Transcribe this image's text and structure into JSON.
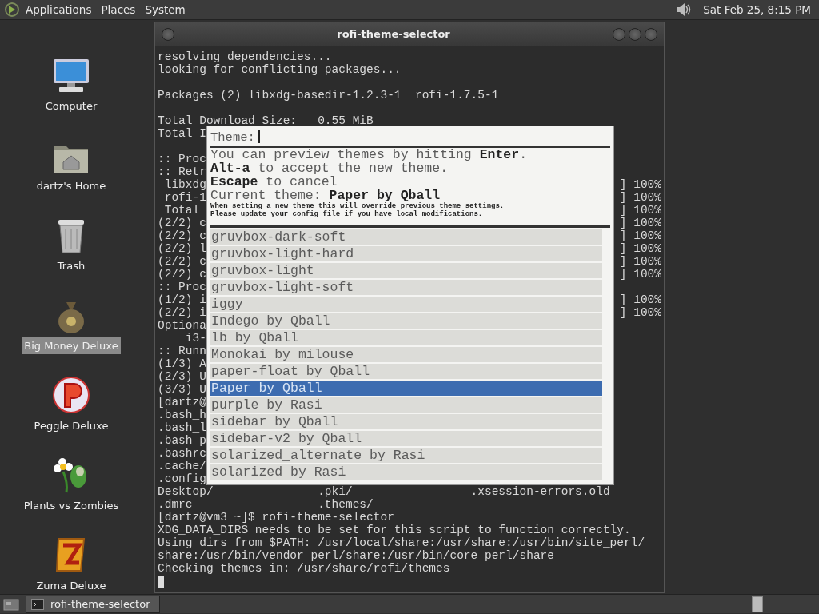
{
  "top_panel": {
    "menus": [
      {
        "label": "Applications"
      },
      {
        "label": "Places"
      },
      {
        "label": "System"
      }
    ],
    "clock": "Sat Feb 25, 8:15 PM"
  },
  "desktop_icons": [
    {
      "label": "Computer",
      "kind": "computer",
      "selected": false
    },
    {
      "label": "dartz's Home",
      "kind": "home",
      "selected": false
    },
    {
      "label": "Trash",
      "kind": "trash",
      "selected": false
    },
    {
      "label": "Big Money Deluxe",
      "kind": "money",
      "selected": true
    },
    {
      "label": "Peggle Deluxe",
      "kind": "ball",
      "selected": false
    },
    {
      "label": "Plants vs Zombies",
      "kind": "flower",
      "selected": false
    },
    {
      "label": "Zuma Deluxe",
      "kind": "tile",
      "selected": false
    }
  ],
  "window": {
    "title": "rofi-theme-selector"
  },
  "terminal": {
    "lines": [
      {
        "text": "resolving dependencies..."
      },
      {
        "text": "looking for conflicting packages..."
      },
      {
        "text": "Packages (2) libxdg-basedir-1.2.3-1  rofi-1.7.5-1",
        "space_before": true
      },
      {
        "text": "Total Download Size:   0.55 MiB",
        "space_before": true
      },
      {
        "text": "Total I"
      },
      {
        "text": ":: Proc",
        "space_before": true
      },
      {
        "text": ":: Retr"
      },
      {
        "text": " libxdg",
        "right": "] 100%"
      },
      {
        "text": " rofi-1",
        "right": "] 100%"
      },
      {
        "text": " Total ",
        "right": "] 100%"
      },
      {
        "text": "(2/2) c",
        "right": "] 100%"
      },
      {
        "text": "(2/2) c",
        "right": "] 100%"
      },
      {
        "text": "(2/2) l",
        "right": "] 100%"
      },
      {
        "text": "(2/2) c",
        "right": "] 100%"
      },
      {
        "text": "(2/2) c",
        "right": "] 100%"
      },
      {
        "text": ":: Proc"
      },
      {
        "text": "(1/2) i",
        "right": "] 100%"
      },
      {
        "text": "(2/2) i",
        "right": "] 100%"
      },
      {
        "text": "Optiona"
      },
      {
        "text": "    i3-"
      },
      {
        "text": ":: Runn"
      },
      {
        "text": "(1/3) A"
      },
      {
        "text": "(2/3) U"
      },
      {
        "text": "(3/3) U"
      },
      {
        "text": "[dartz@"
      },
      {
        "text": ".bash_h"
      },
      {
        "text": ".bash_l"
      },
      {
        "text": ".bash_p"
      },
      {
        "text": ".bashrc"
      },
      {
        "text": ".cache/"
      },
      {
        "text": ".config"
      },
      {
        "text": "Desktop/               .pki/                 .xsession-errors.old"
      },
      {
        "text": ".dmrc                  .themes/"
      },
      {
        "text": "[dartz@vm3 ~]$ rofi-theme-selector"
      },
      {
        "text": "XDG_DATA_DIRS needs to be set for this script to function correctly."
      },
      {
        "text": "Using dirs from $PATH: /usr/local/share:/usr/share:/usr/bin/site_perl/"
      },
      {
        "text": "share:/usr/bin/vendor_perl/share:/usr/bin/core_perl/share"
      },
      {
        "text": "Checking themes in: /usr/share/rofi/themes"
      }
    ]
  },
  "rofi": {
    "prompt": "Theme:",
    "message": [
      "You can preview themes by hitting **Enter**.",
      "**Alt-a** to accept the new theme.",
      "**Escape** to cancel",
      "Current theme: **Paper by Qball**"
    ],
    "note": [
      "When setting a new theme this will override previous theme settings.",
      "Please update your config file if you have local modifications."
    ],
    "items": [
      {
        "label": "gruvbox-dark-soft",
        "selected": false
      },
      {
        "label": "gruvbox-light-hard",
        "selected": false
      },
      {
        "label": "gruvbox-light",
        "selected": false
      },
      {
        "label": "gruvbox-light-soft",
        "selected": false
      },
      {
        "label": "iggy",
        "selected": false
      },
      {
        "label": "Indego by Qball",
        "selected": false
      },
      {
        "label": "lb by Qball",
        "selected": false
      },
      {
        "label": "Monokai by milouse",
        "selected": false
      },
      {
        "label": "paper-float by Qball",
        "selected": false
      },
      {
        "label": "Paper by Qball",
        "selected": true
      },
      {
        "label": "purple by Rasi",
        "selected": false
      },
      {
        "label": "sidebar by Qball",
        "selected": false
      },
      {
        "label": "sidebar-v2 by Qball",
        "selected": false
      },
      {
        "label": "solarized_alternate by Rasi",
        "selected": false
      },
      {
        "label": "solarized by Rasi",
        "selected": false
      }
    ]
  },
  "taskbar": {
    "tasks": [
      {
        "label": "rofi-theme-selector",
        "selected": false
      }
    ]
  }
}
